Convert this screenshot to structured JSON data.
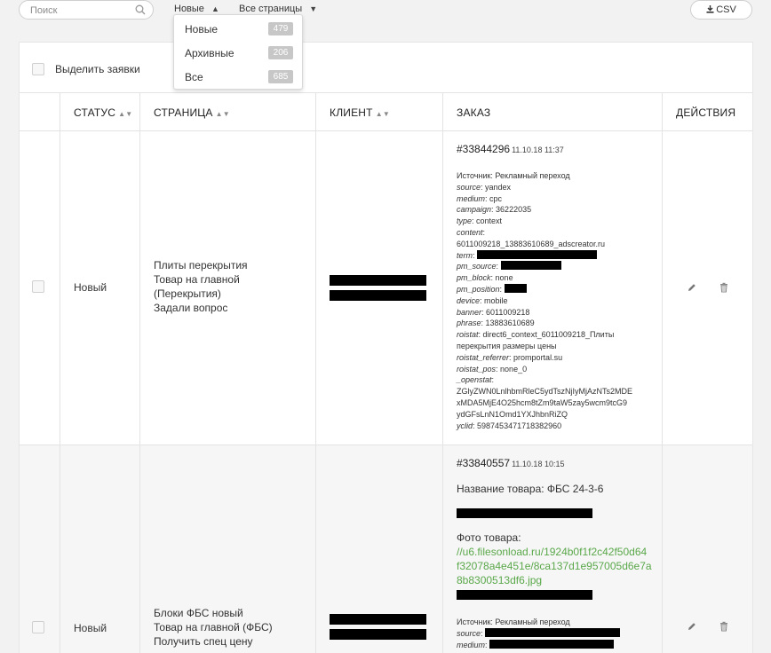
{
  "toolbar": {
    "search_placeholder": "Поиск",
    "filter_status": "Новые",
    "filter_pages": "Все страницы",
    "csv_label": "CSV"
  },
  "dropdown": [
    {
      "label": "Новые",
      "count": "479"
    },
    {
      "label": "Архивные",
      "count": "206"
    },
    {
      "label": "Все",
      "count": "685"
    }
  ],
  "select_all": "Выделить заявки",
  "columns": {
    "status": "СТАТУС",
    "page": "СТРАНИЦА",
    "client": "КЛИЕНТ",
    "order": "ЗАКАЗ",
    "actions": "ДЕЙСТВИЯ"
  },
  "rows": [
    {
      "status": "Новый",
      "page": [
        "Плиты перекрытия",
        "Товар на главной",
        "(Перекрытия)",
        "Задали вопрос"
      ],
      "order_num": "#33844296",
      "order_date": "11.10.18 11:37",
      "details": [
        {
          "k": "",
          "v": "Источник: Рекламный переход"
        },
        {
          "k": "source",
          "v": "yandex"
        },
        {
          "k": "medium",
          "v": "cpc"
        },
        {
          "k": "campaign",
          "v": "36222035"
        },
        {
          "k": "type",
          "v": "context"
        },
        {
          "k": "content",
          "v": ""
        },
        {
          "k": "",
          "v": "6011009218_13883610689_adscreator.ru"
        },
        {
          "k": "term",
          "v": ""
        },
        {
          "k": "pm_source",
          "v": ""
        },
        {
          "k": "pm_block",
          "v": "none"
        },
        {
          "k": "pm_position",
          "v": ""
        },
        {
          "k": "device",
          "v": "mobile"
        },
        {
          "k": "banner",
          "v": "6011009218"
        },
        {
          "k": "phrase",
          "v": "13883610689"
        },
        {
          "k": "roistat",
          "v": "direct6_context_6011009218_Плиты"
        },
        {
          "k": "",
          "v": "перекрытия размеры цены"
        },
        {
          "k": "roistat_referrer",
          "v": "promportal.su"
        },
        {
          "k": "roistat_pos",
          "v": "none_0"
        },
        {
          "k": "_openstat",
          "v": ""
        },
        {
          "k": "",
          "v": "ZGlyZWN0LnlhbmRleC5ydTszNjIyMjAzNTs2MDE"
        },
        {
          "k": "",
          "v": "xMDA5MjE4O25hcm8tZm9taW5zay5wcm9tcG9"
        },
        {
          "k": "",
          "v": "ydGFsLnN1Omd1YXJhbnRiZQ"
        },
        {
          "k": "yclid",
          "v": "5987453471718382960"
        }
      ]
    },
    {
      "status": "Новый",
      "page": [
        "Блоки ФБС новый",
        "Товар на главной (ФБС)",
        "Получить спец цену"
      ],
      "order_num": "#33840557",
      "order_date": "11.10.18 10:15",
      "product_label": "Название товара: ФБС 24-3-6",
      "photo_label": "Фото товара:",
      "photo_link": [
        "//u6.filesonload.ru/1924b0f1f2c42f50d64",
        "f32078a4e451e/8ca137d1e957005d6e7a",
        "8b8300513df6.jpg"
      ],
      "source_line": "Источник: Рекламный переход",
      "source_key": "source",
      "medium_key": "medium"
    }
  ]
}
